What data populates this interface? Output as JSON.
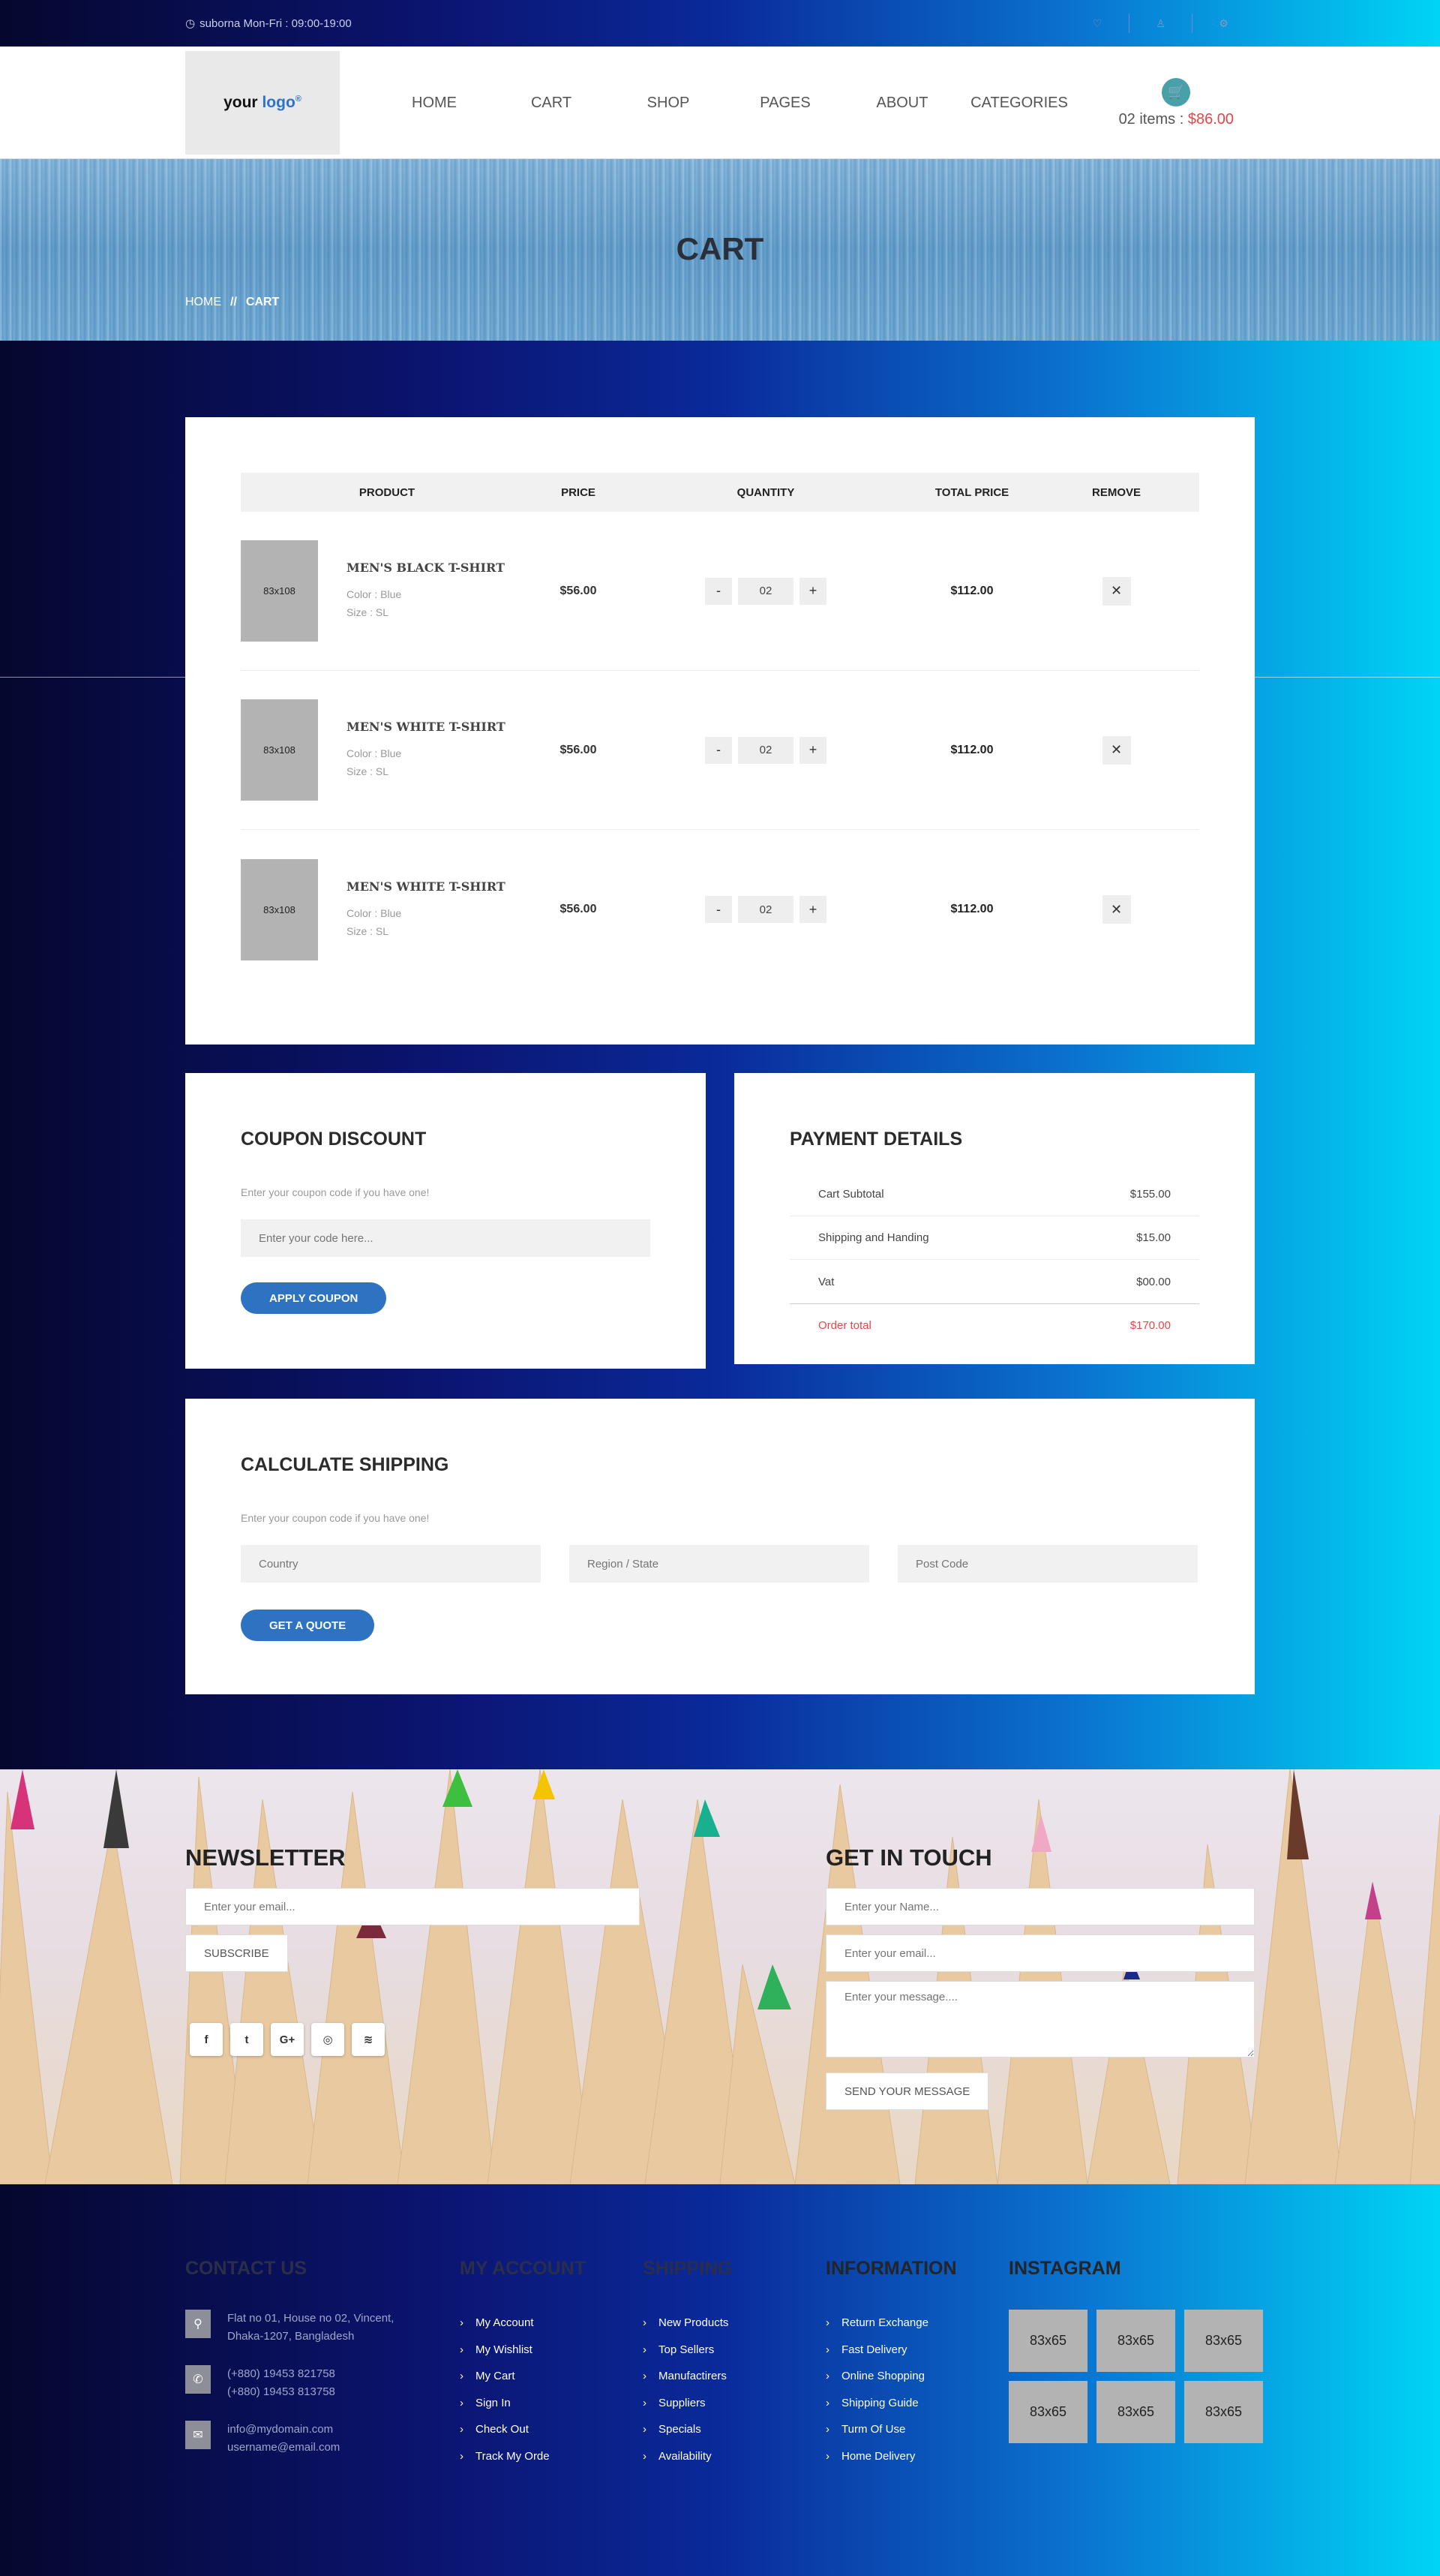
{
  "topbar": {
    "hours": "suborna Mon-Fri : 09:00-19:00",
    "icons": [
      "heart-icon",
      "user-icon",
      "gear-icon"
    ]
  },
  "header": {
    "logo_part1": "your",
    "logo_part2": "logo",
    "logo_mark": "®",
    "nav": [
      "HOME",
      "CART",
      "SHOP",
      "PAGES",
      "ABOUT",
      "CATEGORIES"
    ],
    "cart_items": "02 items : ",
    "cart_price": "$86.00"
  },
  "banner": {
    "title": "CART",
    "crumb_home": "HOME",
    "crumb_sep": "//",
    "crumb_current": "CART"
  },
  "cart": {
    "headers": {
      "product": "PRODUCT",
      "price": "PRICE",
      "quantity": "QUANTITY",
      "total": "TOTAL PRICE",
      "remove": "REMOVE"
    },
    "items": [
      {
        "thumb": "83x108",
        "name": "MEN'S BLACK T-SHIRT",
        "color": "Color : Blue",
        "size": "Size : SL",
        "price": "$56.00",
        "qty": "02",
        "total": "$112.00"
      },
      {
        "thumb": "83x108",
        "name": "MEN'S WHITE T-SHIRT",
        "color": "Color : Blue",
        "size": "Size : SL",
        "price": "$56.00",
        "qty": "02",
        "total": "$112.00"
      },
      {
        "thumb": "83x108",
        "name": "MEN'S WHITE T-SHIRT",
        "color": "Color : Blue",
        "size": "Size : SL",
        "price": "$56.00",
        "qty": "02",
        "total": "$112.00"
      }
    ],
    "minus": "-",
    "plus": "+",
    "remove_glyph": "✕"
  },
  "coupon": {
    "title": "COUPON DISCOUNT",
    "subtitle": "Enter your coupon code if you have one!",
    "placeholder": "Enter your code here...",
    "button": "APPLY COUPON"
  },
  "payment": {
    "title": "PAYMENT DETAILS",
    "rows": [
      {
        "label": "Cart Subtotal",
        "value": "$155.00"
      },
      {
        "label": "Shipping and Handing",
        "value": "$15.00"
      },
      {
        "label": "Vat",
        "value": "$00.00"
      }
    ],
    "total_label": "Order total",
    "total_value": "$170.00"
  },
  "shipping": {
    "title": "CALCULATE SHIPPING",
    "subtitle": "Enter your coupon code if you have one!",
    "country": "Country",
    "region": "Region / State",
    "postcode": "Post Code",
    "button": "GET A QUOTE"
  },
  "newsletter": {
    "title": "NEWSLETTER",
    "placeholder": "Enter your email...",
    "button": "SUBSCRIBE",
    "socials": [
      {
        "name": "facebook-icon",
        "glyph": "f"
      },
      {
        "name": "twitter-icon",
        "glyph": "t"
      },
      {
        "name": "google-plus-icon",
        "glyph": "G+"
      },
      {
        "name": "dribbble-icon",
        "glyph": "◎"
      },
      {
        "name": "rss-icon",
        "glyph": "≋"
      }
    ]
  },
  "contact_form": {
    "title": "GET IN TOUCH",
    "name_placeholder": "Enter your Name...",
    "email_placeholder": "Enter your email...",
    "message_placeholder": "Enter your message....",
    "button": "SEND YOUR MESSAGE"
  },
  "footer": {
    "contact_title": "CONTACT US",
    "address": "Flat no 01, House no 02, Vincent, Dhaka-1207, Bangladesh",
    "phone1": "(+880) 19453 821758",
    "phone2": "(+880) 19453 813758",
    "email1": "info@mydomain.com",
    "email2": "username@email.com",
    "account_title": "MY ACCOUNT",
    "account_links": [
      "My Account",
      "My Wishlist",
      "My Cart",
      "Sign In",
      "Check Out",
      "Track My Orde"
    ],
    "shipping_title": "SHIPPING",
    "shipping_links": [
      "New Products",
      "Top Sellers",
      "Manufactirers",
      "Suppliers",
      "Specials",
      "Availability"
    ],
    "info_title": "INFORMATION",
    "info_links": [
      "Return Exchange",
      "Fast Delivery",
      "Online Shopping",
      "Shipping Guide",
      "Turm Of Use",
      "Home Delivery"
    ],
    "instagram_title": "INSTAGRAM",
    "instagram": [
      "83x65",
      "83x65",
      "83x65",
      "83x65",
      "83x65",
      "83x65"
    ]
  }
}
